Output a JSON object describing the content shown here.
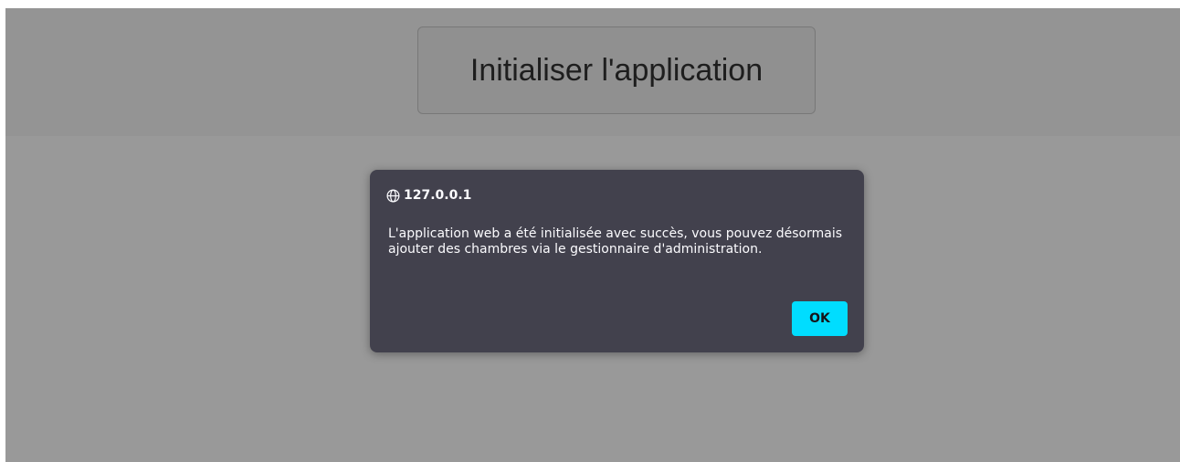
{
  "page": {
    "init_button_label": "Initialiser l'application"
  },
  "dialog": {
    "origin": "127.0.0.1",
    "origin_icon": "globe-icon",
    "message": "L'application web a été initialisée avec succès, vous pouvez désormais ajouter des chambres via le gestionnaire d'administration.",
    "ok_label": "OK"
  },
  "colors": {
    "dialog_background": "#42414d",
    "ok_button": "#00ddff",
    "overlay": "rgba(0,0,0,0.40)"
  }
}
